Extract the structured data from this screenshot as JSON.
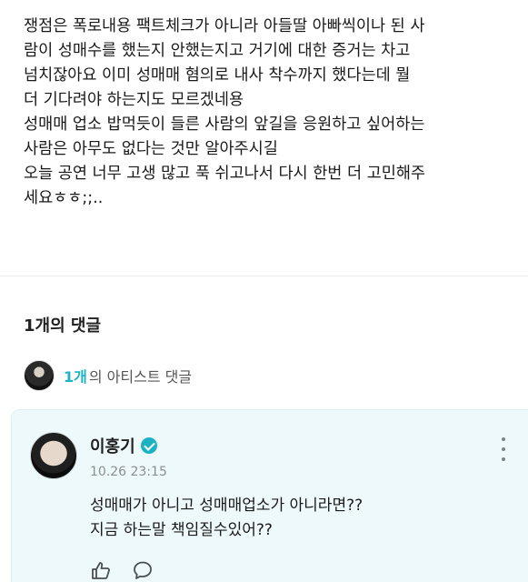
{
  "post": {
    "lines": [
      "쟁점은 폭로내용 팩트체크가 아니라 아들딸 아빠씩이나 된 사",
      "람이 성매수를 했는지 안했는지고 거기에 대한 증거는 차고",
      "넘치잖아요 이미 성매매 혐의로 내사 착수까지 했다는데 뭘",
      "더 기다려야 하는지도 모르겠네용",
      "성매매 업소 밥먹듯이 들른 사람의 앞길을 응원하고 싶어하는",
      "사람은 아무도 없다는 것만 알아주시길",
      "오늘 공연 너무 고생 많고 푹 쉬고나서 다시 한번 더 고민해주",
      "세요ㅎㅎ;;.."
    ]
  },
  "comments_header": {
    "count_label": "1개의 댓글"
  },
  "artist_comments": {
    "count": "1개",
    "label": "의 아티스트 댓글"
  },
  "comment": {
    "author": "이홍기",
    "timestamp": "10.26 23:15",
    "lines": [
      "성매매가 아니고 성매매업소가 아니라면??",
      "지금 하는말 책임질수있어??"
    ]
  },
  "icons": {
    "verified": "verified-badge-icon",
    "more": "more-vertical-icon",
    "like": "like-hand-icon",
    "reply": "reply-bubble-icon"
  },
  "colors": {
    "accent": "#1bb3c4",
    "comment_bg": "#eef9fb"
  }
}
